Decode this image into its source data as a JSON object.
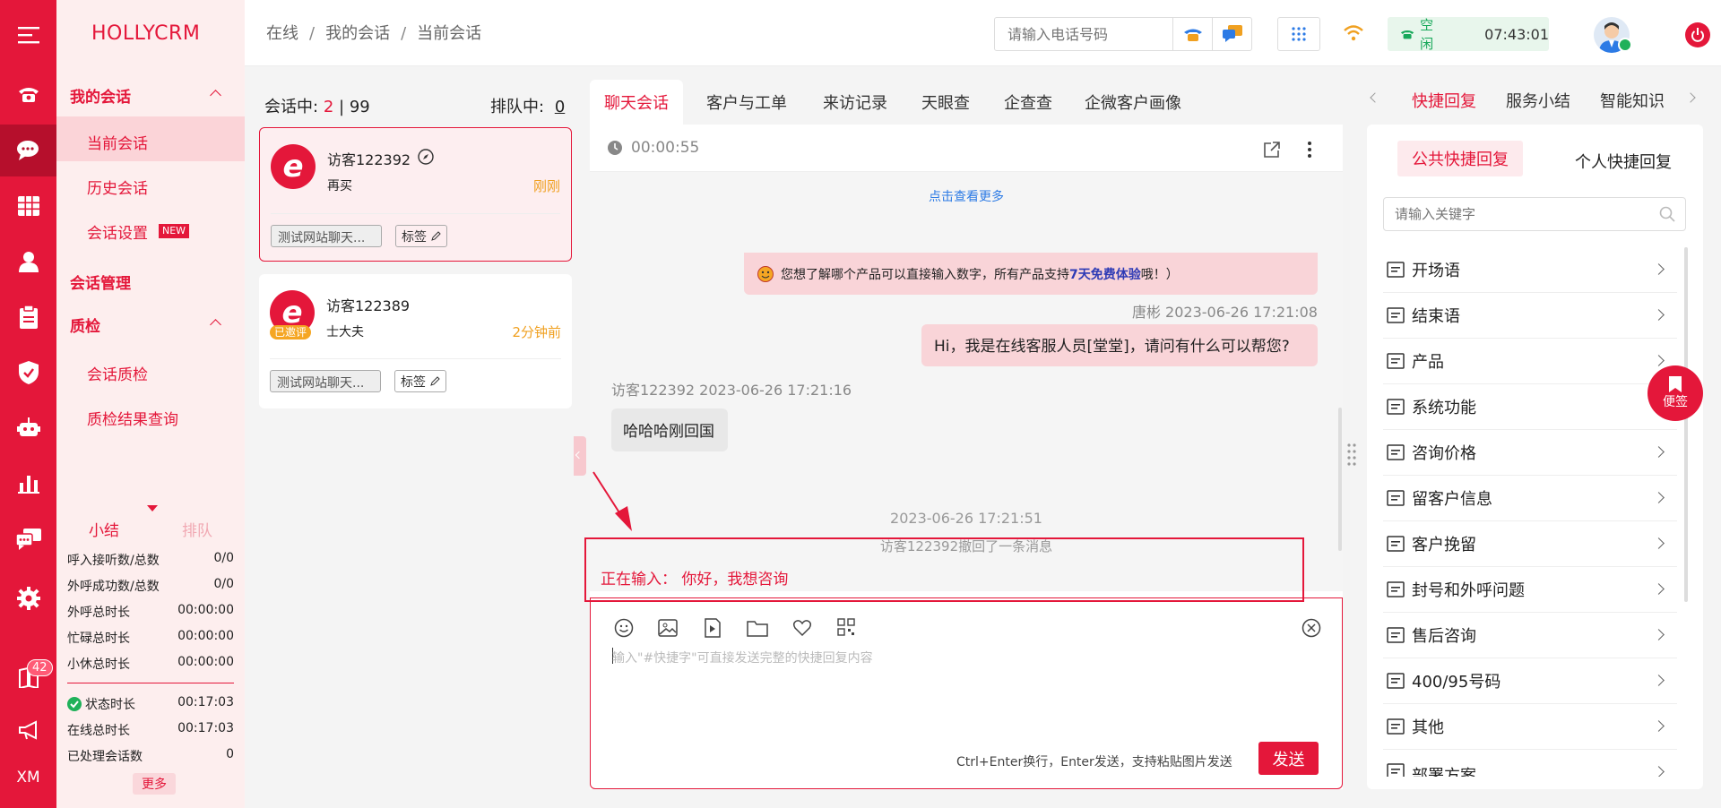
{
  "app": {
    "logo": "HOLLYCRM",
    "rail_xm": "XM",
    "rail_badge": "42"
  },
  "colors": {
    "primary": "#e4173a",
    "online": "#17a85a",
    "time": "#f0a020",
    "link": "#2d7be5"
  },
  "rail_icons": [
    "menu-icon",
    "phone-icon",
    "chat-icon",
    "grid-icon",
    "user-icon",
    "clipboard-icon",
    "shield-icon",
    "robot-icon",
    "bar-chart-icon",
    "message-icon",
    "gear-icon",
    "book-icon",
    "megaphone-icon"
  ],
  "nav": {
    "my_sessions": "我的会话",
    "current_session": "当前会话",
    "history_session": "历史会话",
    "session_settings": "会话设置",
    "new_badge": "NEW",
    "session_mgmt": "会话管理",
    "qc": "质检",
    "session_qc": "会话质检",
    "qc_result": "质检结果查询"
  },
  "stats": {
    "tab_summary": "小结",
    "tab_queue": "排队",
    "rows": [
      {
        "label": "呼入接听数/总数",
        "value": "0/0"
      },
      {
        "label": "外呼成功数/总数",
        "value": "0/0"
      },
      {
        "label": "外呼总时长",
        "value": "00:00:00"
      },
      {
        "label": "忙碌总时长",
        "value": "00:00:00"
      },
      {
        "label": "小休总时长",
        "value": "00:00:00"
      }
    ],
    "rows2": [
      {
        "label": "状态时长",
        "value": "00:17:03"
      },
      {
        "label": "在线总时长",
        "value": "00:17:03"
      },
      {
        "label": "已处理会话数",
        "value": "0"
      }
    ],
    "more": "更多"
  },
  "header": {
    "breadcrumb": [
      "在线",
      "我的会话",
      "当前会话"
    ],
    "sep": "/",
    "phone_placeholder": "请输入电话号码",
    "status": "空闲",
    "time": "07:43:01"
  },
  "sessions": {
    "in_label": "会话中:",
    "in_count": "2",
    "divider": "|",
    "total": "99",
    "queue_label": "排队中:",
    "queue_count": "0",
    "items": [
      {
        "name": "访客122392",
        "msg": "再买",
        "time": "刚刚",
        "tag": "测试网站聊天...",
        "label": "标签"
      },
      {
        "name": "访客122389",
        "msg": "士大夫",
        "time": "2分钟前",
        "tag": "测试网站聊天...",
        "label": "标签",
        "badge": "已邀评"
      }
    ]
  },
  "chat": {
    "tabs": [
      "聊天会话",
      "客户与工单",
      "来访记录",
      "天眼查",
      "企查查",
      "企微客户画像"
    ],
    "timer": "00:00:55",
    "see_more": "点击查看更多",
    "bot_msg_a": "您想了解哪个产品可以直接输入数字，所有产品支持",
    "bot_msg_b": "7天免费体验",
    "bot_msg_c": "哦！）",
    "agent_meta": "唐彬 2023-06-26 17:21:08",
    "agent_msg": "Hi，我是在线客服人员[堂堂]，请问有什么可以帮您?",
    "visitor_meta": "访客122392 2023-06-26 17:21:16",
    "visitor_msg": "哈哈哈刚回国",
    "sys_time": "2023-06-26 17:21:51",
    "recall": "访客122392撤回了一条消息",
    "typing": "正在输入：  你好，我想咨询",
    "input_placeholder": "输入\"#快捷字\"可直接发送完整的快捷回复内容",
    "hint": "Ctrl+Enter换行，Enter发送，支持粘贴图片发送",
    "send": "发送"
  },
  "right": {
    "tabs": [
      "快捷回复",
      "服务小结",
      "智能知识"
    ],
    "public": "公共快捷回复",
    "private": "个人快捷回复",
    "search_placeholder": "请输入关键字",
    "items": [
      "开场语",
      "结束语",
      "产品",
      "系统功能",
      "咨询价格",
      "留客户信息",
      "客户挽留",
      "封号和外呼问题",
      "售后咨询",
      "400/95号码",
      "其他",
      "部署方案"
    ],
    "notes": "便签"
  }
}
